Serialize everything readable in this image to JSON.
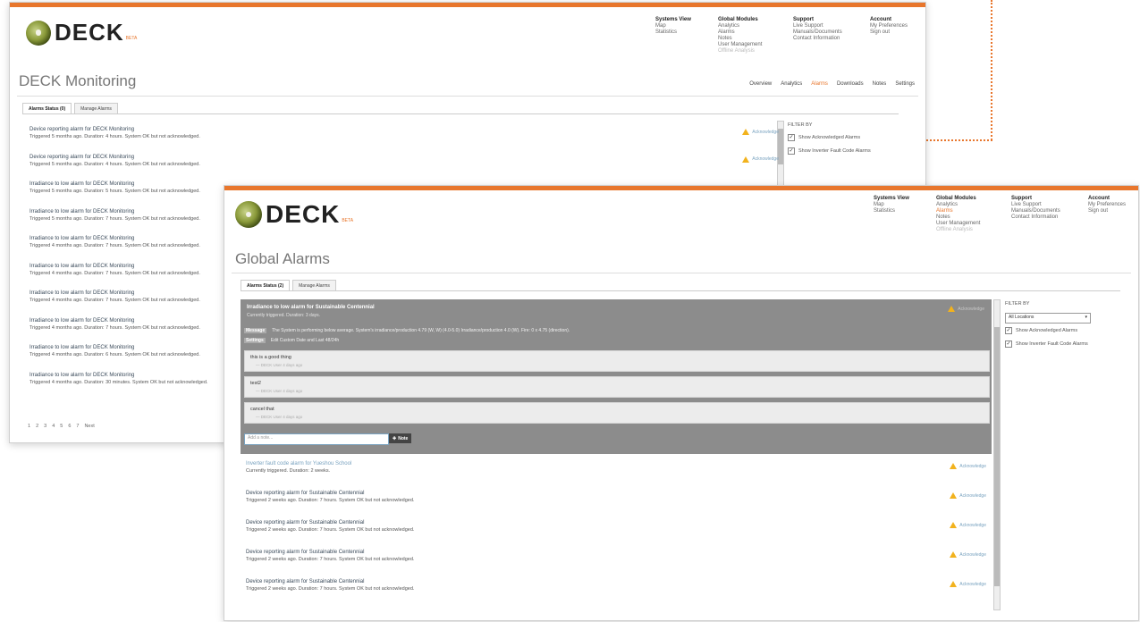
{
  "colors": {
    "accent": "#e8762c",
    "link": "#7aa3c0",
    "warning": "#f2b21d"
  },
  "back": {
    "logo_text": "DECK",
    "logo_beta": "BETA",
    "nav": [
      {
        "heading": "Systems View",
        "items": [
          "Map",
          "Statistics"
        ]
      },
      {
        "heading": "Global Modules",
        "items": [
          "Analytics",
          "Alarms",
          "Notes",
          "User Management",
          "Offline Analysis"
        ]
      },
      {
        "heading": "Support",
        "items": [
          "Live Support",
          "Manuals/Documents",
          "Contact Information"
        ]
      },
      {
        "heading": "Account",
        "items": [
          "My Preferences",
          "Sign out"
        ]
      }
    ],
    "page_title": "DECK Monitoring",
    "subnav": [
      "Overview",
      "Analytics",
      "Alarms",
      "Downloads",
      "Notes",
      "Settings"
    ],
    "subnav_active": "Alarms",
    "tabs": [
      "Alarms Status (0)",
      "Manage Alarms"
    ],
    "alarms": [
      {
        "title": "Device reporting alarm for DECK Monitoring",
        "status": "Triggered 5 months ago. Duration: 4 hours. System OK but not acknowledged.",
        "action": "Acknowledge"
      },
      {
        "title": "Device reporting alarm for DECK Monitoring",
        "status": "Triggered 5 months ago. Duration: 4 hours. System OK but not acknowledged.",
        "action": "Acknowledge"
      },
      {
        "title": "Irradiance to low alarm for DECK Monitoring",
        "status": "Triggered 5 months ago. Duration: 5 hours. System OK but not acknowledged.",
        "action": ""
      },
      {
        "title": "Irradiance to low alarm for DECK Monitoring",
        "status": "Triggered 5 months ago. Duration: 7 hours. System OK but not acknowledged.",
        "action": ""
      },
      {
        "title": "Irradiance to low alarm for DECK Monitoring",
        "status": "Triggered 4 months ago. Duration: 7 hours. System OK but not acknowledged.",
        "action": ""
      },
      {
        "title": "Irradiance to low alarm for DECK Monitoring",
        "status": "Triggered 4 months ago. Duration: 7 hours. System OK but not acknowledged.",
        "action": ""
      },
      {
        "title": "Irradiance to low alarm for DECK Monitoring",
        "status": "Triggered 4 months ago. Duration: 7 hours. System OK but not acknowledged.",
        "action": ""
      },
      {
        "title": "Irradiance to low alarm for DECK Monitoring",
        "status": "Triggered 4 months ago. Duration: 7 hours. System OK but not acknowledged.",
        "action": ""
      },
      {
        "title": "Irradiance to low alarm for DECK Monitoring",
        "status": "Triggered 4 months ago. Duration: 6 hours. System OK but not acknowledged.",
        "action": ""
      },
      {
        "title": "Irradiance to low alarm for DECK Monitoring",
        "status": "Triggered 4 months ago. Duration: 30 minutes. System OK but not acknowledged.",
        "action": ""
      }
    ],
    "filter": {
      "title": "FILTER BY",
      "options": [
        "Show Acknowledged Alarms",
        "Show Inverter Fault Code Alarms"
      ]
    },
    "pager": [
      "1",
      "2",
      "3",
      "4",
      "5",
      "6",
      "7",
      "Next"
    ]
  },
  "front": {
    "logo_text": "DECK",
    "logo_beta": "BETA",
    "nav": [
      {
        "heading": "Systems View",
        "items": [
          "Map",
          "Statistics"
        ]
      },
      {
        "heading": "Global Modules",
        "items": [
          "Analytics",
          "Alarms",
          "Notes",
          "User Management",
          "Offline Analysis"
        ]
      },
      {
        "heading": "Support",
        "items": [
          "Live Support",
          "Manuals/Documents",
          "Contact Information"
        ]
      },
      {
        "heading": "Account",
        "items": [
          "My Preferences",
          "Sign out"
        ]
      }
    ],
    "page_title": "Global Alarms",
    "tabs": [
      "Alarms Status (2)",
      "Manage Alarms"
    ],
    "expanded": {
      "title": "Irradiance to low alarm for Sustainable Centennial",
      "status": "Currently triggered. Duration: 3 days.",
      "action": "Acknowledge",
      "message_label": "Message",
      "message": "The System is performing below average. System's irradiance/production 4.79 (W, W) (4.0-5.0) Irradiance/production 4.0 (W). Fire: 0 x 4.75 (direction).",
      "settings_label": "Settings",
      "settings": "Edit Custom Date and Last 48/24h",
      "notes": [
        {
          "text": "this is a good thing",
          "by": "— DECK User 4 days ago"
        },
        {
          "text": "test2",
          "by": "— DECK User 4 days ago"
        },
        {
          "text": "cancel that",
          "by": "— DECK User 4 days ago"
        }
      ],
      "note_placeholder": "Add a note...",
      "note_button": "Note"
    },
    "alarms": [
      {
        "title": "Inverter fault code alarm for Yueshou School",
        "status": "Currently triggered. Duration: 2 weeks.",
        "action": "Acknowledge"
      },
      {
        "title": "Device reporting alarm for Sustainable Centennial",
        "status": "Triggered 2 weeks ago. Duration: 7 hours. System OK but not acknowledged.",
        "action": "Acknowledge"
      },
      {
        "title": "Device reporting alarm for Sustainable Centennial",
        "status": "Triggered 2 weeks ago. Duration: 7 hours. System OK but not acknowledged.",
        "action": "Acknowledge"
      },
      {
        "title": "Device reporting alarm for Sustainable Centennial",
        "status": "Triggered 2 weeks ago. Duration: 7 hours. System OK but not acknowledged.",
        "action": "Acknowledge"
      },
      {
        "title": "Device reporting alarm for Sustainable Centennial",
        "status": "Triggered 2 weeks ago. Duration: 7 hours. System OK but not acknowledged.",
        "action": "Acknowledge"
      }
    ],
    "filter": {
      "title": "FILTER BY",
      "select_value": "All Locations",
      "options": [
        "Show Acknowledged Alarms",
        "Show Inverter Fault Code Alarms"
      ]
    }
  }
}
